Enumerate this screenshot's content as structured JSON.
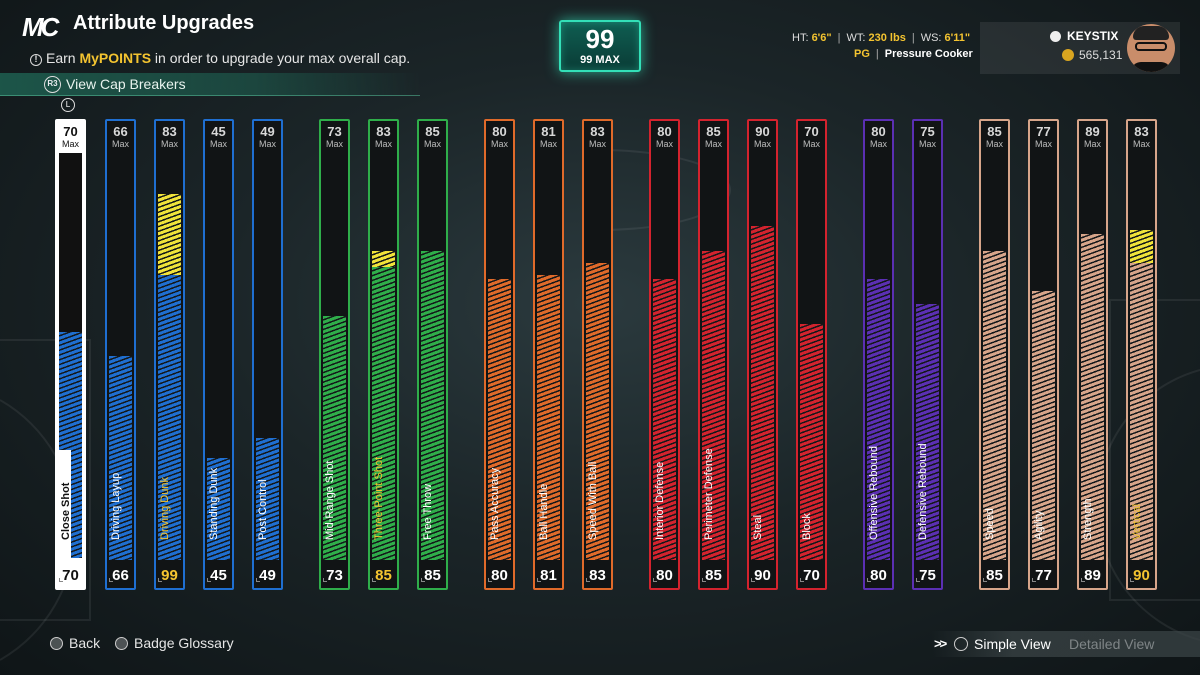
{
  "header": {
    "title": "Attribute Upgrades",
    "subtitle_pre": "Earn ",
    "subtitle_hl": "MyPOINTS",
    "subtitle_post": " in order to upgrade your max overall cap.",
    "cap_breakers": "View Cap Breakers",
    "r3_button": "R3",
    "logo": "MC",
    "info_icon": "!"
  },
  "overall": {
    "value": "99",
    "max_label": "99 MAX"
  },
  "player": {
    "ht_label": "HT:",
    "ht": "6'6\"",
    "wt_label": "WT:",
    "wt": "230 lbs",
    "ws_label": "WS:",
    "ws": "6'11\"",
    "position": "PG",
    "archetype": "Pressure Cooker",
    "username": "KEYSTIX",
    "vc": "565,131"
  },
  "stick_label": "L",
  "max_word": "Max",
  "colors": {
    "inside": "#1f6fd1",
    "shooting": "#2fae4a",
    "playmaking": "#e06a2a",
    "defense": "#d4232e",
    "rebounding": "#5b2fb3",
    "athleticism": "#d7a58a",
    "over_cap": "#f1e33a",
    "overall_glow": "#33e0b8"
  },
  "attributes": [
    {
      "name": "Close Shot",
      "current": 70,
      "max": 70,
      "fill": 56,
      "group": "inside",
      "selected": true
    },
    {
      "name": "Driving Layup",
      "current": 66,
      "max": 66,
      "fill": 50,
      "group": "inside"
    },
    {
      "name": "Driving Dunk",
      "current": 99,
      "max": 83,
      "fill": 70,
      "over": 20,
      "group": "inside",
      "gold": true
    },
    {
      "name": "Standing Dunk",
      "current": 45,
      "max": 45,
      "fill": 25,
      "group": "inside"
    },
    {
      "name": "Post Control",
      "current": 49,
      "max": 49,
      "fill": 30,
      "group": "inside"
    },
    {
      "name": "Mid-Range Shot",
      "current": 73,
      "max": 73,
      "fill": 60,
      "group": "shooting"
    },
    {
      "name": "Three-Point Shot",
      "current": 85,
      "max": 83,
      "fill": 72,
      "over": 4,
      "group": "shooting",
      "gold": true
    },
    {
      "name": "Free Throw",
      "current": 85,
      "max": 85,
      "fill": 76,
      "group": "shooting"
    },
    {
      "name": "Pass Accuracy",
      "current": 80,
      "max": 80,
      "fill": 69,
      "group": "playmaking"
    },
    {
      "name": "Ball Handle",
      "current": 81,
      "max": 81,
      "fill": 70,
      "group": "playmaking"
    },
    {
      "name": "Speed With Ball",
      "current": 83,
      "max": 83,
      "fill": 73,
      "group": "playmaking"
    },
    {
      "name": "Interior Defense",
      "current": 80,
      "max": 80,
      "fill": 69,
      "group": "defense"
    },
    {
      "name": "Perimeter Defense",
      "current": 85,
      "max": 85,
      "fill": 76,
      "group": "defense"
    },
    {
      "name": "Steal",
      "current": 90,
      "max": 90,
      "fill": 82,
      "group": "defense"
    },
    {
      "name": "Block",
      "current": 70,
      "max": 70,
      "fill": 58,
      "group": "defense"
    },
    {
      "name": "Offensive Rebound",
      "current": 80,
      "max": 80,
      "fill": 69,
      "group": "rebounding"
    },
    {
      "name": "Defensive Rebound",
      "current": 75,
      "max": 75,
      "fill": 63,
      "group": "rebounding"
    },
    {
      "name": "Speed",
      "current": 85,
      "max": 85,
      "fill": 76,
      "group": "athleticism"
    },
    {
      "name": "Agility",
      "current": 77,
      "max": 77,
      "fill": 66,
      "group": "athleticism"
    },
    {
      "name": "Strength",
      "current": 89,
      "max": 89,
      "fill": 80,
      "group": "athleticism"
    },
    {
      "name": "Vertical",
      "current": 90,
      "max": 83,
      "fill": 73,
      "over": 8,
      "group": "athleticism",
      "gold": true
    }
  ],
  "footer": {
    "back": "Back",
    "glossary": "Badge Glossary",
    "chevrons": ">>",
    "simple_view": "Simple View",
    "detailed_view": "Detailed View"
  }
}
